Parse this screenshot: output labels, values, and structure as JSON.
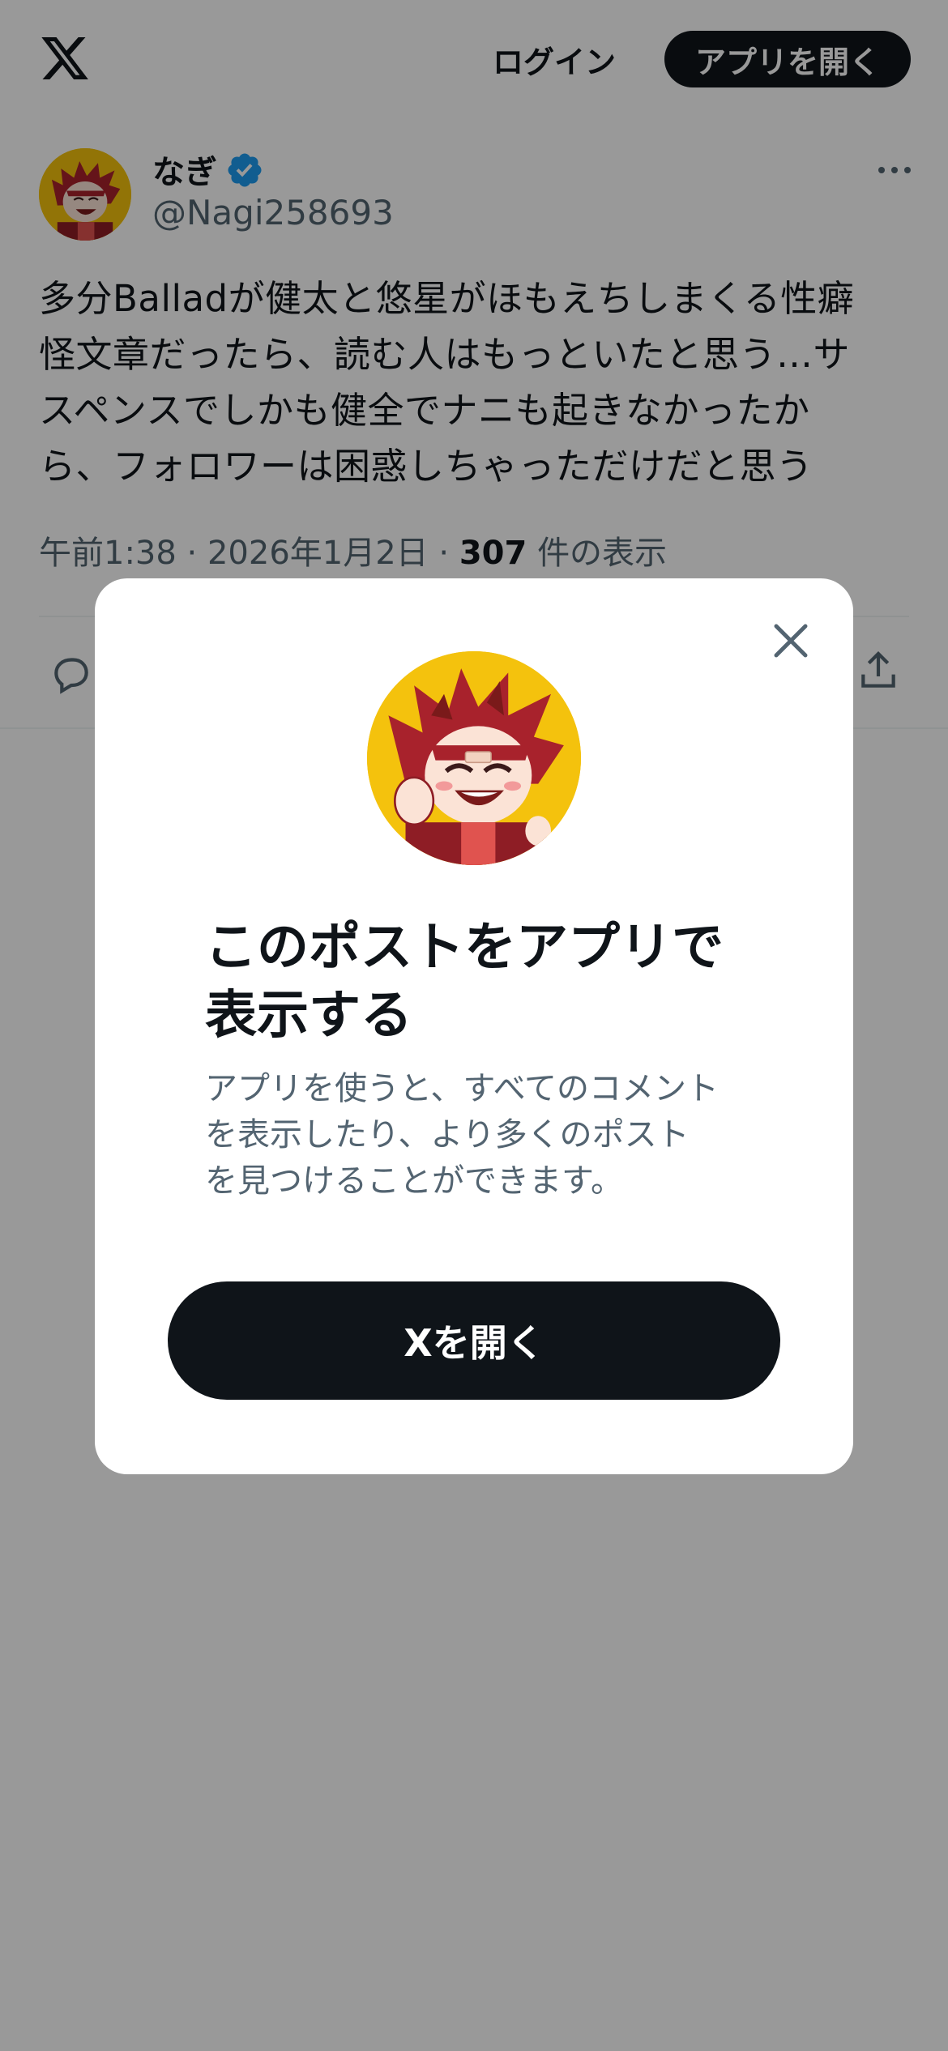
{
  "header": {
    "logo_icon": "x-logo-icon",
    "login_label": "ログイン",
    "open_app_label": "アプリを開く"
  },
  "post": {
    "author": {
      "display_name": "なぎ",
      "handle": "@Nagi258693",
      "verified": true,
      "verified_color": "#1d9bf0"
    },
    "text_lines": [
      "多分Balladが健太と悠星がほもえちしまくる性癖",
      "怪文章だったら、読む人はもっといたと思う…サ",
      "スペンスでしかも健全でナニも起きなかったか",
      "ら、フォロワーは困惑しちゃっただけだと思う"
    ],
    "time": "午前1:38",
    "separator": "·",
    "date": "2026年1月2日",
    "views_count": "307",
    "views_label": "件の表示"
  },
  "modal": {
    "title_line1": "このポストをアプリで",
    "title_line2": "表示する",
    "desc_line1": "アプリを使うと、すべてのコメント",
    "desc_line2": "を表示したり、より多くのポスト",
    "desc_line3": "を見つけることができます。",
    "button_label": "Xを開く"
  },
  "colors": {
    "text": "#0f1419",
    "secondary": "#536471",
    "overlay": "rgba(0,0,0,0.4)",
    "avatar_bg": "#f4c20d",
    "hair": "#a8222c"
  }
}
